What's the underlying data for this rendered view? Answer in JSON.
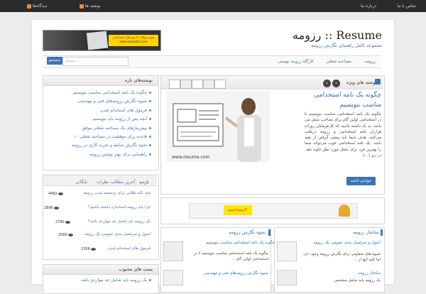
{
  "topbar": {
    "contact": "تماس با ما",
    "about": "درباره ما",
    "posts_rss": "نوشته ها",
    "comments_rss": "دیدگاه‌ها"
  },
  "site": {
    "title": "رزومه :: Resume",
    "tagline": "مجموعه کامل راهنمای نگارش رزومه"
  },
  "banner": {
    "text": "نمونه سوالات آزمون‌های استخدامی",
    "url": "www.smsjobs1.com"
  },
  "nav": {
    "items": [
      "رزومه",
      "مصاحبه شغلی",
      "کارگاه رزومه نویسی"
    ]
  },
  "search": {
    "placeholder": "جستجو ...",
    "button": "جستجو"
  },
  "recent_posts": {
    "title": "نوشته‌های تازه",
    "items": [
      "چگونه یک نامه استخدامی مناسب بنویسیم",
      "شیوه نگارش رزومه‌های فنی و مهندسی",
      "فرمول های استخدام شدن",
      "آنچه پس از رزومه باید بنویسیم",
      "پیش‌نیازهای یک مصاحبه شغلی موفق",
      "۱۰ قاعده برای موفقیت در مصاحبه شغلی",
      "نحوه نگارش سابقه و تجربه کاری در رزومه",
      "راهنمایی برای بهتر نوشتن رزومه"
    ]
  },
  "featured": {
    "tab_label": "نوشته های ویژه",
    "title": "چگونه یک نامه استخدامی مناسب بنویسیم",
    "excerpt": "چگونه یک نامه استخدامی مناسب بنویسیم تا در استخدامی اولین گام برای تصاحب شغل می باشد. به یاد داشته باشید که کارفرمایان روزانه هزاران نامه استخدامی و رزومه دریافت می‌کنند. هدف شما باید پیشی گرفتن از بقیه باشد. یک نامه استخدامی خوب می‌تواند شما را بهترین فرد برای شغل مورد نظر جلوه دهد. در زیر [...]",
    "read_more": "خواندن ادامه",
    "image_url": "www.resume.com"
  },
  "tabs": [
    "بازدید",
    "آخرین مطالب",
    "نظرات",
    "بایگانی"
  ],
  "popular": [
    {
      "title": "چند نکته طلایی برای برجسته شدن رزومه",
      "count": "4482"
    },
    {
      "title": "چرا باید رزومه استاندارد داشته باشیم؟",
      "count": "2896"
    },
    {
      "title": "یک رزومه باید شامل چه مواردی باشد؟",
      "count": "2780"
    },
    {
      "title": "اصول و سرفصل بندی عمومی یک رزومه",
      "count": "2560"
    },
    {
      "title": "فرمول های استخدام شدن",
      "count": "2356"
    }
  ],
  "favorite_posts": {
    "title": "پست های محبوب",
    "items": [
      "یک رزومه باید شامل چه مواردی باشد"
    ]
  },
  "ad": {
    "text": "استخدام‌شو!"
  },
  "categories": {
    "right": {
      "title": "ساختار رزومه",
      "post1_link": "اصول و سرفصل بندی عمومی یک رزومه",
      "post1_text": "شیوه های متفاوتی برای نگارش رزومه وجود دارد اما کلیه آنها از ...",
      "post2_link": "ساختار رزومه",
      "post2_text": "یک رزومه باید شامل مشخص"
    },
    "middle": {
      "title": "نحوه نگارش رزومه",
      "post1_link": "چگونه یک نامه استخدامی مناسب بنویسیم",
      "post1_text": "چگونه یک نامه استخدامی مناسب بنویسیم تا در استخدامی اولین گام ...",
      "post2_link": "شیوه نگارش رزومه‌های فنی و مهندسی"
    }
  }
}
